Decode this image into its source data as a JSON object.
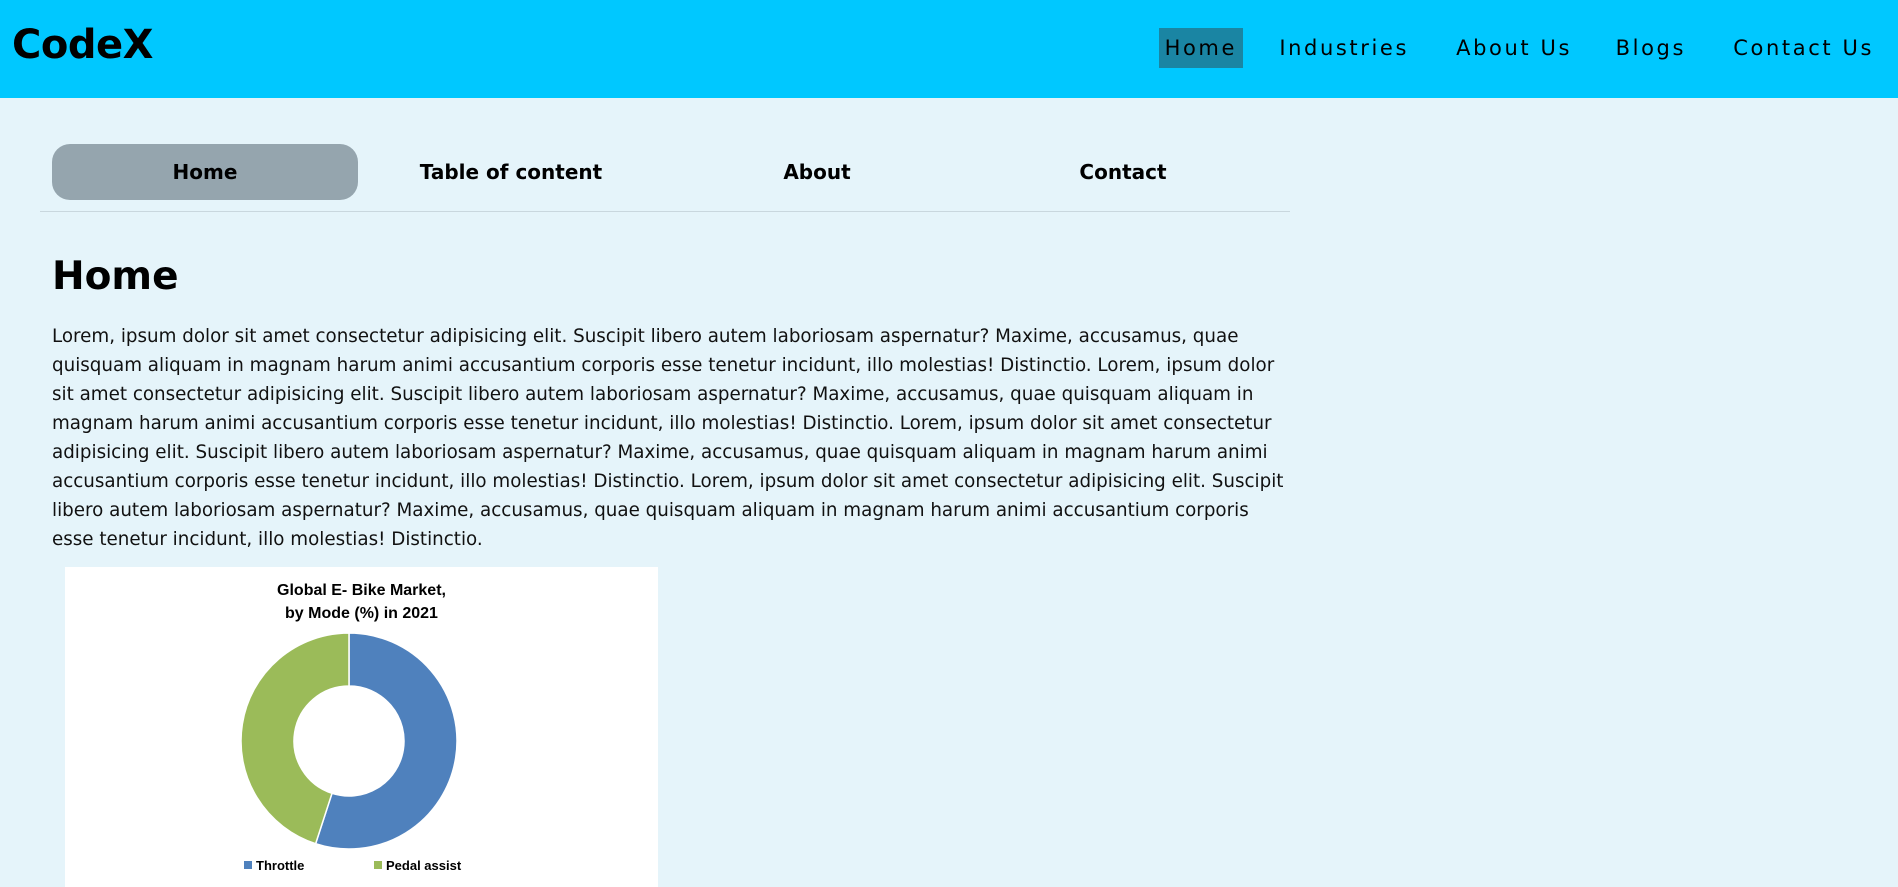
{
  "header": {
    "logo": "CodeX",
    "nav": [
      {
        "label": "Home",
        "active": true
      },
      {
        "label": "Industries",
        "active": false
      },
      {
        "label": "About Us",
        "active": false
      },
      {
        "label": "Blogs",
        "active": false
      },
      {
        "label": "Contact Us",
        "active": false
      }
    ]
  },
  "subnav": {
    "tabs": [
      {
        "label": "Home",
        "active": true
      },
      {
        "label": "Table of content",
        "active": false
      },
      {
        "label": "About",
        "active": false
      },
      {
        "label": "Contact",
        "active": false
      }
    ]
  },
  "main": {
    "title": "Home",
    "paragraph": "Lorem, ipsum dolor sit amet consectetur adipisicing elit. Suscipit libero autem laboriosam aspernatur? Maxime, accusamus, quae quisquam aliquam in magnam harum animi accusantium corporis esse tenetur incidunt, illo molestias! Distinctio. Lorem, ipsum dolor sit amet consectetur adipisicing elit. Suscipit libero autem laboriosam aspernatur? Maxime, accusamus, quae quisquam aliquam in magnam harum animi accusantium corporis esse tenetur incidunt, illo molestias! Distinctio. Lorem, ipsum dolor sit amet consectetur adipisicing elit. Suscipit libero autem laboriosam aspernatur? Maxime, accusamus, quae quisquam aliquam in magnam harum animi accusantium corporis esse tenetur incidunt, illo molestias! Distinctio. Lorem, ipsum dolor sit amet consectetur adipisicing elit. Suscipit libero autem laboriosam aspernatur? Maxime, accusamus, quae quisquam aliquam in magnam harum animi accusantium corporis esse tenetur incidunt, illo molestias! Distinctio."
  },
  "colors": {
    "header_bg": "#00c8ff",
    "page_bg": "#e5f4fa",
    "active_nav_bg": "#1a85a3",
    "active_tab_bg": "#95a5ae"
  },
  "chart_data": {
    "type": "pie",
    "variant": "donut",
    "title_lines": [
      "Global E- Bike Market,",
      "by Mode (%) in 2021"
    ],
    "categories": [
      "Throttle",
      "Pedal assist"
    ],
    "values": [
      55,
      45
    ],
    "colors": [
      "#4f81bd",
      "#9bbb59"
    ],
    "legend_position": "bottom"
  }
}
